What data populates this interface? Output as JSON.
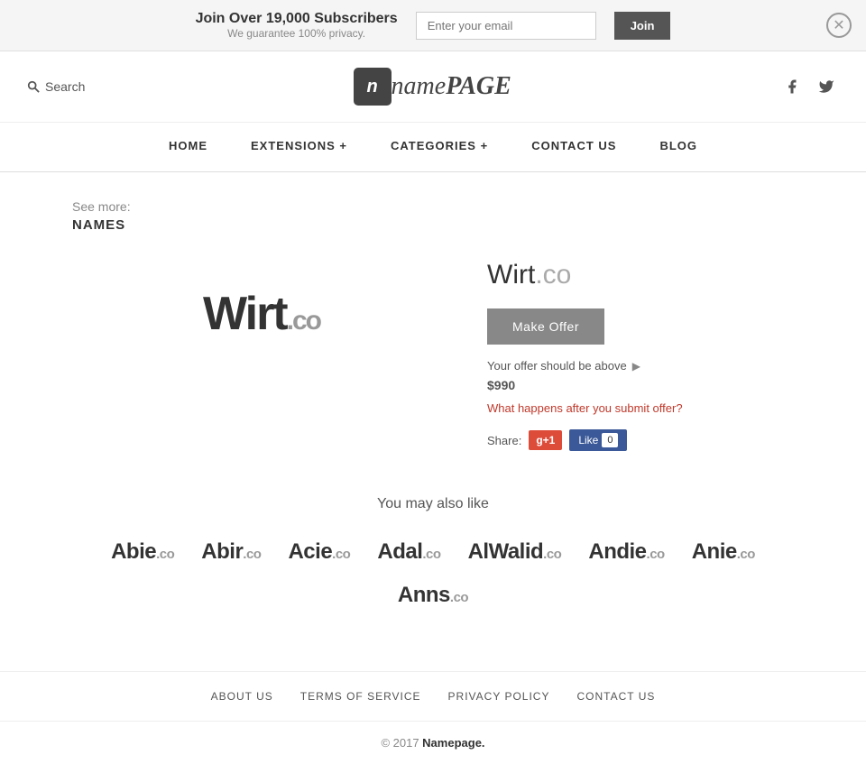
{
  "banner": {
    "main_text": "Join Over 19,000 Subscribers",
    "sub_text": "We guarantee 100% privacy.",
    "email_placeholder": "Enter your email",
    "join_label": "Join"
  },
  "header": {
    "search_label": "Search",
    "logo_n": "n",
    "logo_name": "name",
    "logo_page": "PAGE",
    "facebook_icon": "f",
    "twitter_icon": "t"
  },
  "nav": {
    "items": [
      {
        "label": "HOME",
        "id": "home"
      },
      {
        "label": "EXTENSIONS +",
        "id": "extensions"
      },
      {
        "label": "CATEGORIES +",
        "id": "categories"
      },
      {
        "label": "CONTACT US",
        "id": "contact"
      },
      {
        "label": "BLOG",
        "id": "blog"
      }
    ]
  },
  "see_more": {
    "label": "See more:",
    "link_label": "NAMES"
  },
  "domain": {
    "name": "Wirt",
    "tld": ".co",
    "full": "Wirt.co",
    "make_offer_label": "Make Offer",
    "offer_prefix": "Your offer should be above",
    "offer_price": "$990",
    "offer_question": "What happens after you submit offer?",
    "share_label": "Share:",
    "gplus_label": "g+1",
    "fb_label": "Like",
    "fb_count": "0"
  },
  "also_like": {
    "title": "You may also like",
    "items": [
      {
        "name": "Abie",
        "tld": ".co"
      },
      {
        "name": "Abir",
        "tld": ".co"
      },
      {
        "name": "Acie",
        "tld": ".co"
      },
      {
        "name": "Adal",
        "tld": ".co"
      },
      {
        "name": "AlWalid",
        "tld": ".co"
      },
      {
        "name": "Andie",
        "tld": ".co"
      },
      {
        "name": "Anie",
        "tld": ".co"
      },
      {
        "name": "Anns",
        "tld": ".co"
      }
    ]
  },
  "footer": {
    "links": [
      {
        "label": "ABOUT US",
        "id": "about"
      },
      {
        "label": "TERMS OF SERVICE",
        "id": "terms"
      },
      {
        "label": "PRIVACY POLICY",
        "id": "privacy"
      },
      {
        "label": "CONTACT US",
        "id": "contact"
      }
    ],
    "copy_text": "© 2017 ",
    "copy_brand": "Namepage."
  }
}
